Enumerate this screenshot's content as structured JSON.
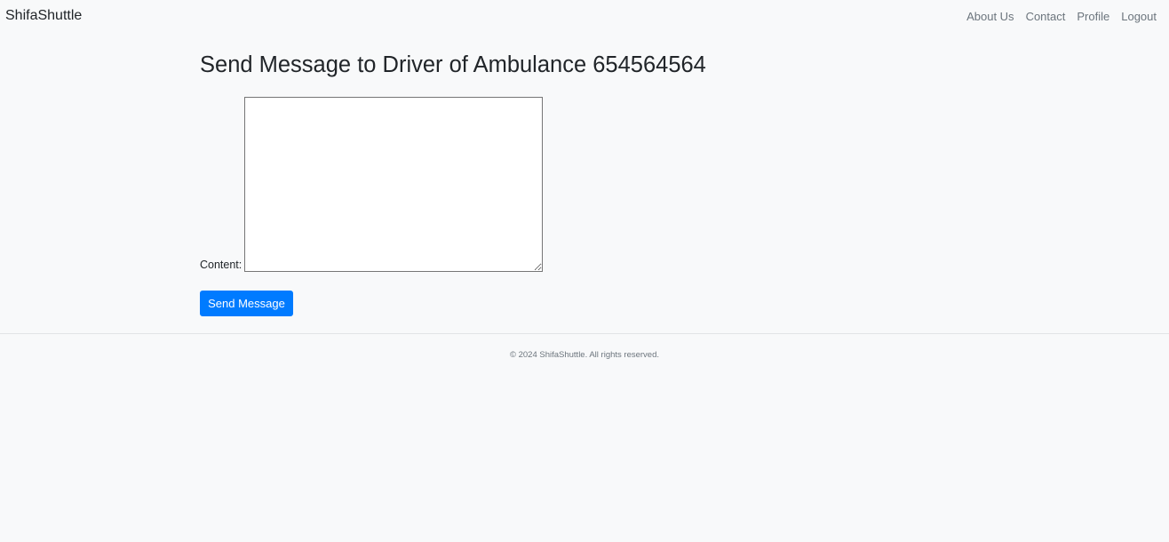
{
  "navbar": {
    "brand": "ShifaShuttle",
    "links": [
      {
        "label": "About Us"
      },
      {
        "label": "Contact"
      },
      {
        "label": "Profile"
      },
      {
        "label": "Logout"
      }
    ]
  },
  "main": {
    "title": "Send Message to Driver of Ambulance 654564564",
    "form": {
      "content_label": "Content:",
      "content_value": "",
      "submit_label": "Send Message"
    }
  },
  "footer": {
    "text": "© 2024 ShifaShuttle. All rights reserved."
  },
  "colors": {
    "background": "#f8f9fa",
    "primary": "#007bff",
    "muted_text": "#6c757d"
  }
}
